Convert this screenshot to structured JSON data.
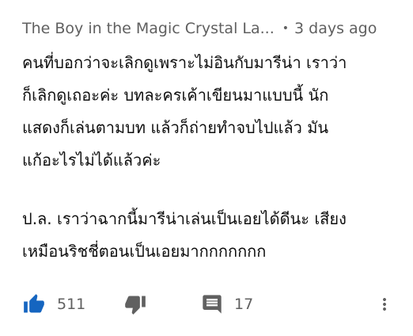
{
  "comment": {
    "author": "The Boy in the Magic Crystal La...",
    "separator": "•",
    "time": "3 days ago",
    "paragraph1_lines": [
      "คนที่บอกว่าจะเลิกดูเพราะไม่อินกับมารีน่า เราว่า",
      "ก็เลิกดูเถอะค่ะ บทละครเค้าเขียนมาแบบนี้ นัก",
      "แสดงก็เล่นตามบท แล้วก็ถ่ายทำจบไปแล้ว มัน",
      "แก้อะไรไม่ได้แล้วค่ะ"
    ],
    "paragraph2_lines": [
      "ป.ล. เราว่าฉากนี้มารีน่าเล่นเป็นเอยได้ดีนะ เสียง",
      "เหมือนริชชี่ตอนเป็นเอยมากกกกกกก"
    ],
    "actions": {
      "like_count": "511",
      "reply_count": "17"
    }
  },
  "colors": {
    "like_icon": "#1565c0",
    "secondary_text": "#606060",
    "icon_gray": "#606060"
  },
  "icons": {
    "like": "thumb-up-filled-icon",
    "dislike": "thumb-down-icon",
    "replies": "comment-icon",
    "more": "more-vert-icon"
  }
}
